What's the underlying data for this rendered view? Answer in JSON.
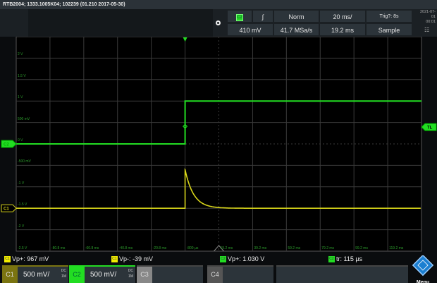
{
  "title": "RTB2004; 1333.1005K04; 102239 (01.210 2017-05-30)",
  "header": {
    "trigger_source": "C2",
    "trigger_slope": "∫",
    "trigger_mode": "Norm",
    "time_scale": "20 ms/",
    "trigger_status": "Trig?: 8s",
    "trigger_level": "410 mV",
    "sample_rate": "41.7 MSa/s",
    "time_position": "19.2 ms",
    "acquisition": "Sample",
    "date": "2021-07-01",
    "time": "00:01",
    "network_icon": "network-icon"
  },
  "grid": {
    "y_labels": [
      "2 V",
      "1.5 V",
      "1 V",
      "500 mV",
      "0 V",
      "-500 mV",
      "-1 V",
      "-1.5 V",
      "-2 V"
    ],
    "x_labels": [
      "-2.5 V",
      "-80.8 ms",
      "-60.8 ms",
      "-40.8 ms",
      "-20.8 ms",
      "-800 µs",
      "19.2 ms",
      "39.2 ms",
      "59.2 ms",
      "79.2 ms",
      "99.2 ms",
      "119.2 ms"
    ],
    "c2_marker": "C2",
    "c1_marker": "C1",
    "trigger_level_marker": "TL"
  },
  "waveforms": {
    "colors": {
      "C1": "#d9d61a",
      "C2": "#22dd22"
    },
    "trigger_time_ms": -0.8,
    "C2": {
      "low_v": 0,
      "high_v": 1.0
    },
    "C1": {
      "base_v": -1.5,
      "peak_v": -0.6,
      "decay_tau_ms": 5
    }
  },
  "measurements": [
    {
      "ch": "C1",
      "text": "Vp+: 967 mV",
      "color": "#f0ec00"
    },
    {
      "ch": "C1",
      "text": "Vp-: -39 mV",
      "color": "#f0ec00"
    },
    {
      "ch": "C2",
      "text": "Vp+: 1.030 V",
      "color": "#22dd22"
    },
    {
      "ch": "C2",
      "text": "tr: 115 µs",
      "color": "#22dd22"
    }
  ],
  "channels": [
    {
      "name": "C1",
      "scale": "500 mV/",
      "coupling": "DC",
      "imp": "1M"
    },
    {
      "name": "C2",
      "scale": "500 mV/",
      "coupling": "DC",
      "imp": "1M"
    },
    {
      "name": "C3"
    },
    {
      "name": "C4"
    }
  ],
  "menu_label": "Menu"
}
